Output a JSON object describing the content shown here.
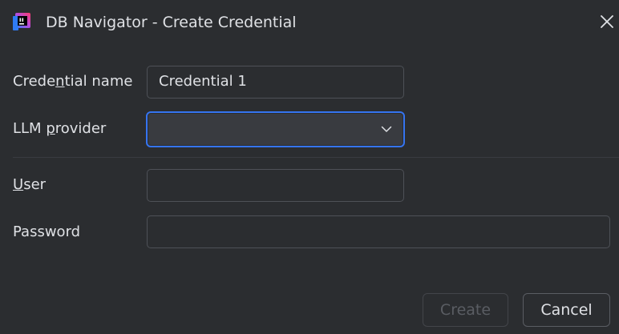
{
  "window": {
    "title": "DB Navigator - Create Credential",
    "app_icon": "db-navigator-app-icon",
    "close_icon": "close-icon"
  },
  "form": {
    "credential_name": {
      "label": "Credential name",
      "mnemonic": "n",
      "value": "Credential 1"
    },
    "llm_provider": {
      "label": "LLM provider",
      "mnemonic": "p",
      "selected": "",
      "icon": "chevron-down-icon"
    },
    "user": {
      "label": "User",
      "mnemonic": "U",
      "value": ""
    },
    "password": {
      "label": "Password",
      "value": ""
    }
  },
  "buttons": {
    "create": "Create",
    "cancel": "Cancel"
  },
  "colors": {
    "background": "#2b2d30",
    "focus_border": "#3574f0",
    "field_border": "#4e5157",
    "text": "#dfe1e5",
    "disabled_text": "#5a5d63"
  }
}
